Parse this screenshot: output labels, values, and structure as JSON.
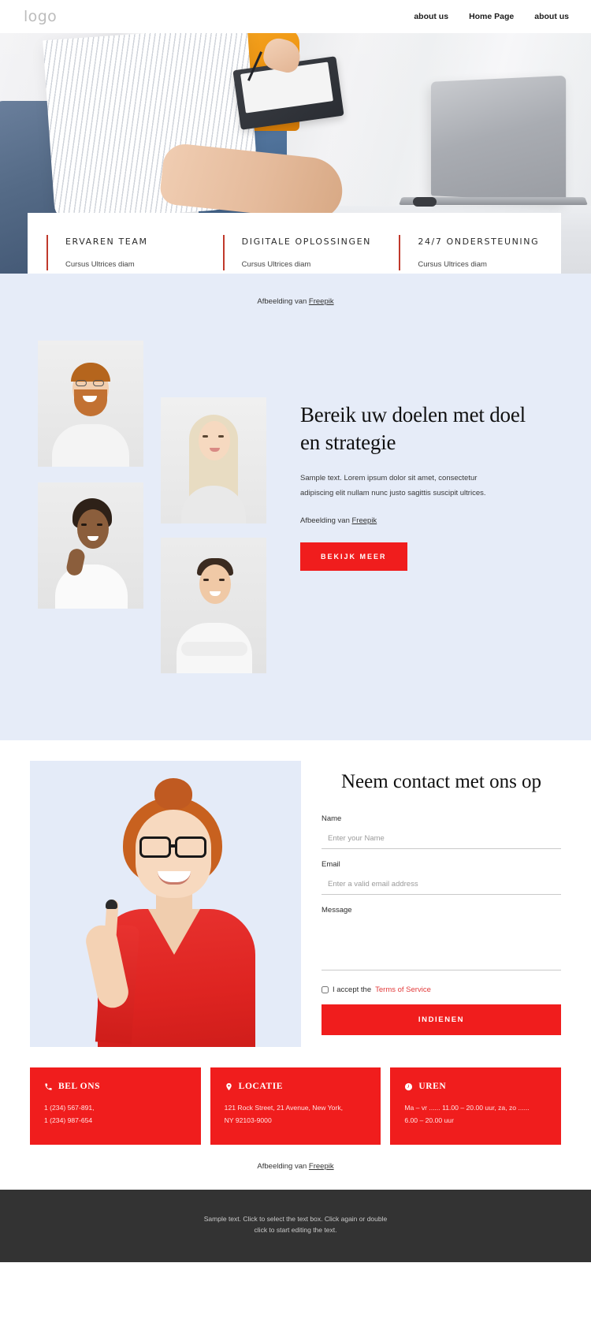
{
  "header": {
    "logo": "logo",
    "nav": [
      {
        "label": "about us"
      },
      {
        "label": "Home Page"
      },
      {
        "label": "about us"
      }
    ]
  },
  "features": [
    {
      "title": "ERVAREN TEAM",
      "desc": "Cursus Ultrices diam"
    },
    {
      "title": "DIGITALE OPLOSSINGEN",
      "desc": "Cursus Ultrices diam"
    },
    {
      "title": "24/7 ONDERSTEUNING",
      "desc": "Cursus Ultrices diam"
    }
  ],
  "credits": {
    "prefix": "Afbeelding van ",
    "link": "Freepik"
  },
  "goals": {
    "heading": "Bereik uw doelen met doel en strategie",
    "body": "Sample text. Lorem ipsum dolor sit amet, consectetur adipiscing elit nullam nunc justo sagittis suscipit ultrices.",
    "button": "BEKIJK MEER"
  },
  "contact": {
    "heading": "Neem contact met ons op",
    "fields": [
      {
        "label": "Name",
        "placeholder": "Enter your Name",
        "value": ""
      },
      {
        "label": "Email",
        "placeholder": "Enter a valid email address",
        "value": ""
      },
      {
        "label": "Message",
        "placeholder": "",
        "value": ""
      }
    ],
    "accept_prefix": "I accept the ",
    "accept_link": "Terms of Service",
    "submit": "INDIENEN"
  },
  "info_cards": [
    {
      "icon": "phone-icon",
      "title": "BEL ONS",
      "lines": [
        "1 (234) 567-891,",
        "1 (234) 987-654"
      ]
    },
    {
      "icon": "location-pin-icon",
      "title": "LOCATIE",
      "lines": [
        "121 Rock Street, 21 Avenue, New York,",
        "NY 92103-9000"
      ]
    },
    {
      "icon": "clock-icon",
      "title": "UREN",
      "lines": [
        "Ma – vr ...... 11.00 – 20.00 uur, za, zo ......",
        "6.00 – 20.00 uur"
      ]
    }
  ],
  "footer": {
    "line1": "Sample text. Click to select the text box. Click again or double",
    "line2": "click to start editing the text."
  },
  "colors": {
    "accent_red": "#f01d1d",
    "feature_border": "#c0392b",
    "section_bg": "#e6ecf8",
    "footer_bg": "#333333"
  }
}
